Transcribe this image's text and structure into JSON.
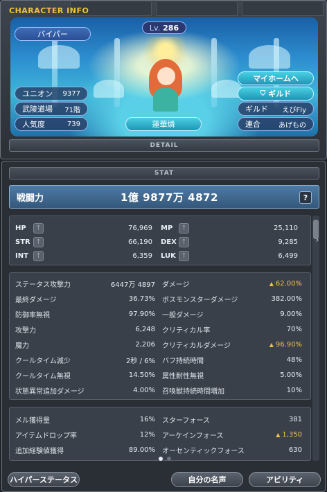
{
  "window": {
    "title": "CHARACTER INFO",
    "detail_label": "DETAIL"
  },
  "profile": {
    "job": "バイパー",
    "level_prefix": "Lv.",
    "level": "286",
    "name": "蓮華燐",
    "union_label": "ユニオン",
    "union_value": "9377",
    "dojo_label": "武陵道場",
    "dojo_value": "71階",
    "fame_label": "人気度",
    "fame_value": "739",
    "myhome_button": "マイホームへ",
    "guild_button": "ギルド",
    "guild_label": "ギルド",
    "guild_value": "えびFly",
    "alliance_label": "連合",
    "alliance_value": "あげもの"
  },
  "stat": {
    "header": "STAT",
    "power_label": "戦闘力",
    "power_value": "1億 9877万 4872",
    "help": "?",
    "ap": [
      {
        "left": {
          "name": "HP",
          "value": "76,969"
        },
        "right": {
          "name": "MP",
          "value": "25,110"
        }
      },
      {
        "left": {
          "name": "STR",
          "value": "66,190"
        },
        "right": {
          "name": "DEX",
          "value": "9,285"
        }
      },
      {
        "left": {
          "name": "INT",
          "value": "6,359"
        },
        "right": {
          "name": "LUK",
          "value": "6,499"
        }
      }
    ],
    "main": [
      {
        "l_key": "ステータス攻撃力",
        "l_val": "6447万 4897",
        "r_key": "ダメージ",
        "r_val": "62.00%",
        "r_up": true
      },
      {
        "l_key": "最終ダメージ",
        "l_val": "36.73%",
        "r_key": "ボスモンスターダメージ",
        "r_val": "382.00%",
        "r_up": false
      },
      {
        "l_key": "防御率無視",
        "l_val": "97.90%",
        "r_key": "一般ダメージ",
        "r_val": "9.00%",
        "r_up": false
      },
      {
        "l_key": "攻撃力",
        "l_val": "6,248",
        "r_key": "クリティカル率",
        "r_val": "70%",
        "r_up": false
      },
      {
        "l_key": "魔力",
        "l_val": "2,206",
        "r_key": "クリティカルダメージ",
        "r_val": "96.90%",
        "r_up": true
      },
      {
        "l_key": "クールタイム減少",
        "l_val": "2秒 / 6%",
        "r_key": "バフ持続時間",
        "r_val": "48%",
        "r_up": false
      },
      {
        "l_key": "クールタイム無視",
        "l_val": "14.50%",
        "r_key": "属性耐性無視",
        "r_val": "5.00%",
        "r_up": false
      },
      {
        "l_key": "状態異常追加ダメージ",
        "l_val": "4.00%",
        "r_key": "召喚獣持続時間増加",
        "r_val": "10%",
        "r_up": false
      }
    ],
    "misc": [
      {
        "l_key": "メル獲得量",
        "l_val": "16%",
        "r_key": "スターフォース",
        "r_val": "381",
        "r_up": false
      },
      {
        "l_key": "アイテムドロップ率",
        "l_val": "12%",
        "r_key": "アーケインフォース",
        "r_val": "1,350",
        "r_up": true
      },
      {
        "l_key": "追加経験値獲得",
        "l_val": "89.00%",
        "r_key": "オーセンティックフォース",
        "r_val": "630",
        "r_up": false
      }
    ]
  },
  "buttons": {
    "hyper_stat": "ハイパーステータス",
    "name_card": "自分の名声",
    "ability": "アビリティ"
  },
  "colors": {
    "accent_gold": "#f2c14a",
    "title_gold": "#f0c23a",
    "cyan_button": "#1f95b6"
  }
}
